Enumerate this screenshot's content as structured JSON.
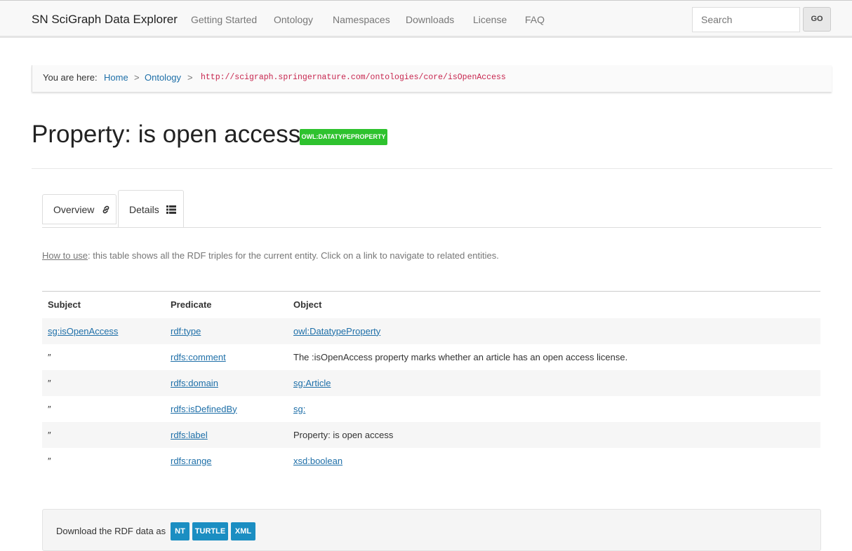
{
  "navbar": {
    "brand": "SN SciGraph Data Explorer",
    "items": [
      "Getting Started",
      "Ontology",
      "Namespaces",
      "Downloads",
      "License",
      "FAQ"
    ],
    "search_placeholder": "Search",
    "go_label": "GO"
  },
  "breadcrumb": {
    "prefix": "You are here:",
    "home": "Home",
    "ontology": "Ontology",
    "sep": ">",
    "uri": "http://scigraph.springernature.com/ontologies/core/isOpenAccess"
  },
  "page": {
    "title": "Property: is open access",
    "badge": "OWL:DATATYPEPROPERTY"
  },
  "tabs": {
    "overview": "Overview",
    "details": "Details"
  },
  "howto": {
    "link": "How to use",
    "text": ": this table shows all the RDF triples for the current entity. Click on a link to navigate to related entities."
  },
  "table": {
    "headers": [
      "Subject",
      "Predicate",
      "Object"
    ],
    "rows": [
      {
        "subject": "sg:isOpenAccess",
        "predicate": "rdf:type",
        "object": "owl:DatatypeProperty"
      },
      {
        "subject": "″",
        "predicate": "rdfs:comment",
        "object": "The :isOpenAccess property marks whether an article has an open access license."
      },
      {
        "subject": "″",
        "predicate": "rdfs:domain",
        "object": "sg:Article"
      },
      {
        "subject": "″",
        "predicate": "rdfs:isDefinedBy",
        "object": "sg:"
      },
      {
        "subject": "″",
        "predicate": "rdfs:label",
        "object": "Property: is open access"
      },
      {
        "subject": "″",
        "predicate": "rdfs:range",
        "object": "xsd:boolean"
      }
    ]
  },
  "footer": {
    "text": "Download the RDF data as",
    "formats": [
      "NT",
      "TURTLE",
      "XML"
    ]
  },
  "colors": {
    "badge": "#2ec22e",
    "link": "#1e6fa8",
    "download_button": "#1b8ec2",
    "uri": "#c7254e"
  }
}
